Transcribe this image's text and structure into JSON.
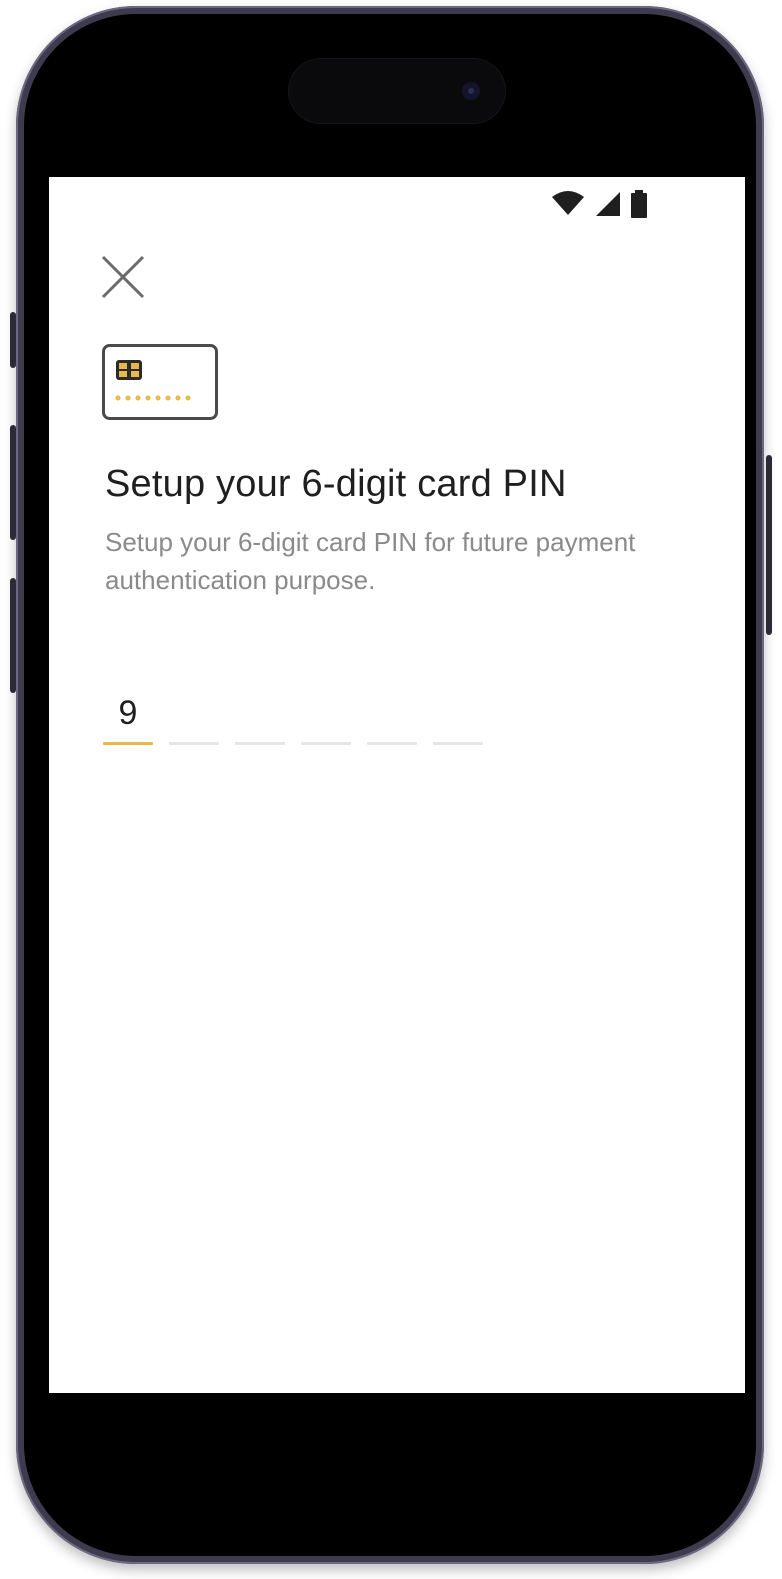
{
  "screen": {
    "status_bar": {
      "icons": [
        "wifi-icon",
        "cellular-signal-icon",
        "battery-icon"
      ]
    },
    "close_button": {
      "icon": "close-icon"
    },
    "card_icon": {
      "icon": "card-chip-icon",
      "accent": "#e8b84a"
    },
    "title": "Setup your 6-digit card PIN",
    "subtitle": "Setup your 6-digit card PIN for future payment authentication purpose.",
    "pin": {
      "length": 6,
      "digits": [
        "9",
        "",
        "",
        "",
        "",
        ""
      ],
      "active_color": "#e8b84a",
      "inactive_color": "#e6e6e6"
    }
  }
}
